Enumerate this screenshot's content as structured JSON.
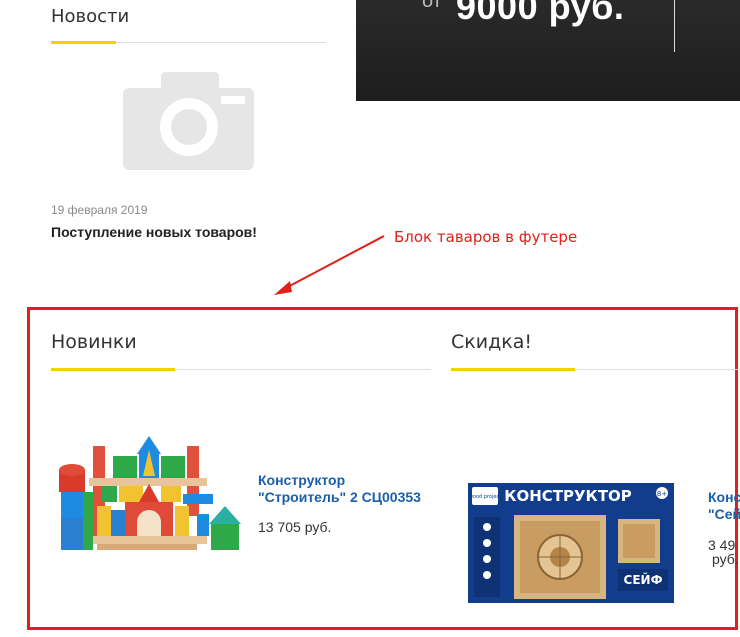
{
  "news": {
    "title": "Новости",
    "image_icon": "camera-placeholder-icon",
    "date": "19 февраля 2019",
    "headline": "Поступление новых товаров!"
  },
  "banner": {
    "prefix": "от",
    "price": "9000 руб."
  },
  "annotation": {
    "label": "Блок таваров в футере",
    "color": "#e0201a"
  },
  "sections": {
    "new": {
      "title": "Новинки",
      "product": {
        "name_line1": "Конструктор",
        "name_line2": "\"Строитель\" 2 СЦ00353",
        "price": "13 705 руб."
      }
    },
    "sale": {
      "title": "Скидка!",
      "product": {
        "name_line1": "Конс",
        "name_line2": "\"Сей",
        "price": "3 49",
        "price_line2": "руб.",
        "box_brand": "wood project",
        "box_title": "КОНСТРУКТОР",
        "box_subtitle": "СЕЙФ",
        "box_age": "8+"
      }
    }
  },
  "colors": {
    "accent_yellow": "#f5d000",
    "link_blue": "#1a5fa8"
  }
}
